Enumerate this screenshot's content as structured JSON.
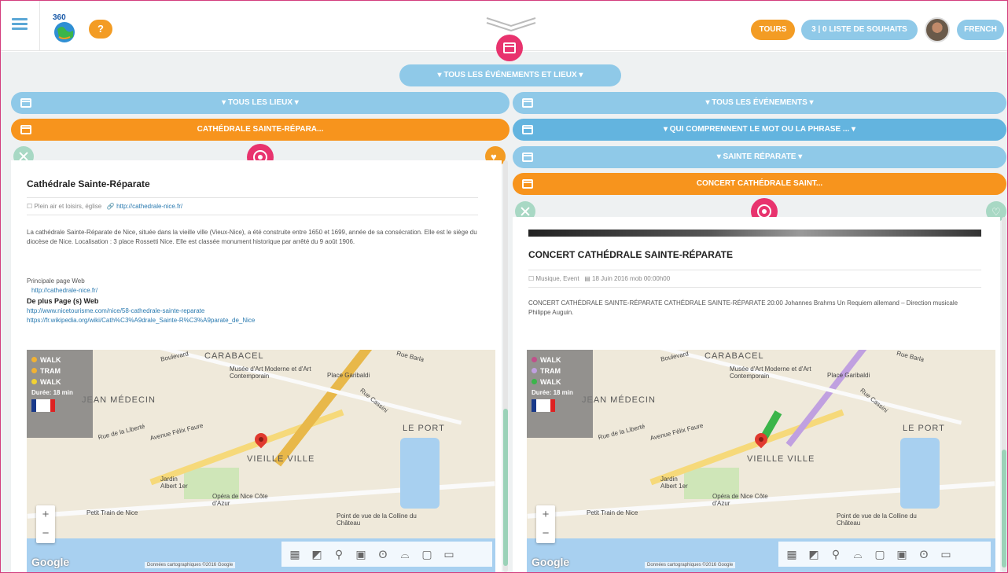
{
  "header": {
    "help_label": "?",
    "tours_label": "TOURS",
    "wishlist_label": "3 | 0 LISTE DE SOUHAITS",
    "language_label": "FRENCH"
  },
  "filters": {
    "all_events_places": "▾ TOUS LES ÉVÉNEMENTS ET LIEUX ▾"
  },
  "left": {
    "bar_all_places": "▾ TOUS LES LIEUX ▾",
    "bar_selected": "CATHÉDRALE SAINTE-RÉPARA...",
    "title": "Cathédrale Sainte-Réparate",
    "meta_category": "Plein air et loisirs, église",
    "meta_url": "http://cathedrale-nice.fr/",
    "description": "La cathédrale Sainte-Réparate de Nice, située dans la vieille ville (Vieux-Nice), a été construite entre 1650 et 1699, année de sa consécration. Elle est le siège du diocèse de Nice. Localisation : 3 place Rossetti Nice. Elle est classée monument historique par arrêté du 9 août 1906.",
    "main_web_label": "Principale page Web",
    "main_web_url": "http://cathedrale-nice.fr/",
    "more_pages_label": "De plus Page (s) Web",
    "more_url_1": "http://www.nicetourisme.com/nice/58-cathedrale-sainte-reparate",
    "more_url_2": "https://fr.wikipedia.org/wiki/Cath%C3%A9drale_Sainte-R%C3%A9parate_de_Nice",
    "legend": {
      "rows": [
        "WALK",
        "TRAM",
        "WALK"
      ],
      "colors": [
        "#f2b233",
        "#f2b233",
        "#f2d233"
      ],
      "duration": "Durée: 18 min"
    }
  },
  "right": {
    "bar_all_events": "▾ TOUS LES ÉVÉNEMENTS ▾",
    "bar_contains": "▾ QUI COMPRENNENT LE MOT OU LA PHRASE ... ▾",
    "bar_keyword": "▾ SAINTE RÉPARATE ▾",
    "bar_selected": "CONCERT CATHÉDRALE SAINT...",
    "title": "CONCERT CATHÉDRALE SAINTE-RÉPARATE",
    "meta_category": "Musique, Event",
    "meta_date": "18 Juin 2016 mob 00:00h00",
    "description": "CONCERT CATHÉDRALE SAINTE-RÉPARATE CATHÉDRALE SAINTE-RÉPARATE 20:00 Johannes Brahms Un Requiem allemand – Direction musicale Philippe Auguin.",
    "legend": {
      "rows": [
        "WALK",
        "TRAM",
        "WALK"
      ],
      "colors": [
        "#c0508a",
        "#c0a0e0",
        "#3bb54a"
      ],
      "duration": "Durée: 18 min"
    }
  },
  "map": {
    "labels": {
      "carabacel": "CARABACEL",
      "musee": "Musée d'Art Moderne et d'Art Contemporain",
      "garibaldi": "Place Garibaldi",
      "saint_medecin": "JEAN MÉDECIN",
      "le_port": "LE PORT",
      "vieille_ville": "VIEILLE VILLE",
      "opera": "Opéra de Nice Côte d'Azur",
      "petit_train": "Petit Train de Nice",
      "colline": "Point de vue de la Colline du Château",
      "felix_faure": "Avenue Félix Faure",
      "albert": "Jardin Albert 1er",
      "cassini": "Rue Cassini",
      "barla": "Rue Barla",
      "liberte": "Rue de la Liberté",
      "boulevard": "Boulevard"
    },
    "zoom_in": "+",
    "zoom_out": "−",
    "google": "Google",
    "credit": "Données cartographiques ©2016 Google"
  },
  "colors": {
    "accent_orange": "#f7941d",
    "accent_blue": "#8fc9e8",
    "accent_pink": "#e8336e",
    "accent_green": "#a8d8c4"
  }
}
